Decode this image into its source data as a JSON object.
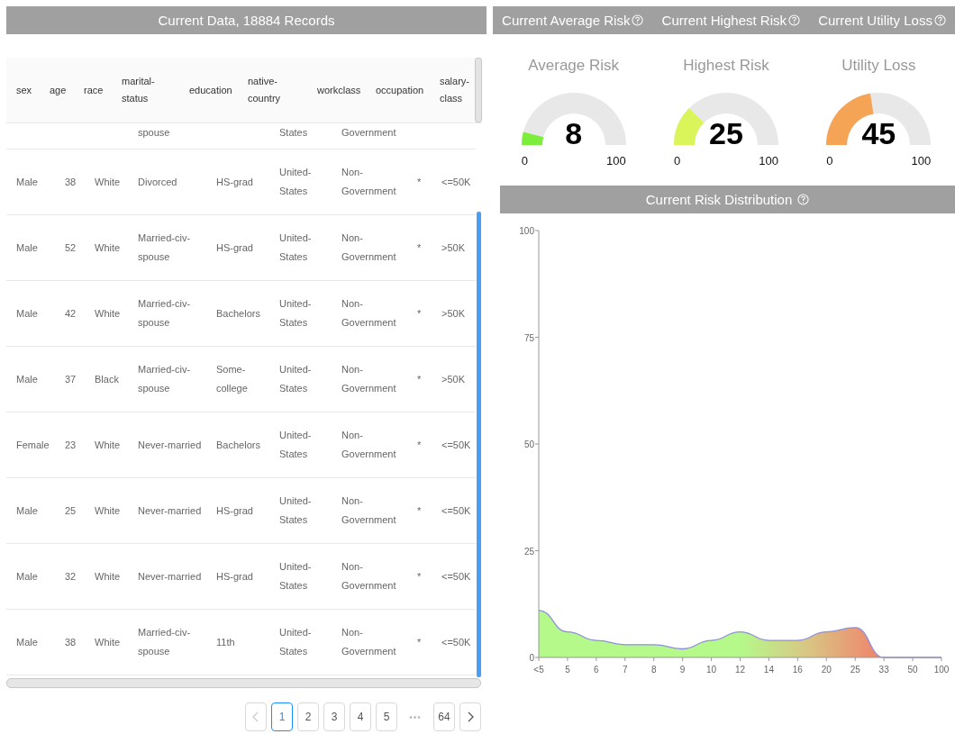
{
  "data_panel": {
    "title": "Current Data, 18884 Records",
    "columns": [
      "sex",
      "age",
      "race",
      "marital-\nstatus",
      "education",
      "native-\ncountry",
      "workclass",
      "occupation",
      "salary-\nclass"
    ],
    "partial_row": {
      "marital_status": "spouse",
      "native_country": "States",
      "workclass": "Government"
    },
    "rows": [
      [
        "Male",
        "38",
        "White",
        "Divorced",
        "HS-grad",
        "United-\nStates",
        "Non-\nGovernment",
        "*",
        "<=50K"
      ],
      [
        "Male",
        "52",
        "White",
        "Married-civ-\nspouse",
        "HS-grad",
        "United-\nStates",
        "Non-\nGovernment",
        "*",
        ">50K"
      ],
      [
        "Male",
        "42",
        "White",
        "Married-civ-\nspouse",
        "Bachelors",
        "United-\nStates",
        "Non-\nGovernment",
        "*",
        ">50K"
      ],
      [
        "Male",
        "37",
        "Black",
        "Married-civ-\nspouse",
        "Some-\ncollege",
        "United-\nStates",
        "Non-\nGovernment",
        "*",
        ">50K"
      ],
      [
        "Female",
        "23",
        "White",
        "Never-married",
        "Bachelors",
        "United-\nStates",
        "Non-\nGovernment",
        "*",
        "<=50K"
      ],
      [
        "Male",
        "25",
        "White",
        "Never-married",
        "HS-grad",
        "United-\nStates",
        "Non-\nGovernment",
        "*",
        "<=50K"
      ],
      [
        "Male",
        "32",
        "White",
        "Never-married",
        "HS-grad",
        "United-\nStates",
        "Non-\nGovernment",
        "*",
        "<=50K"
      ],
      [
        "Male",
        "38",
        "White",
        "Married-civ-\nspouse",
        "11th",
        "United-\nStates",
        "Non-\nGovernment",
        "*",
        "<=50K"
      ]
    ],
    "pagination": {
      "pages": [
        {
          "label": "1",
          "selected": true
        },
        {
          "label": "2",
          "selected": false
        },
        {
          "label": "3",
          "selected": false
        },
        {
          "label": "4",
          "selected": false
        },
        {
          "label": "5",
          "selected": false
        }
      ],
      "ellipsis": "•••",
      "last": {
        "label": "64",
        "selected": false
      }
    }
  },
  "metrics_header": [
    "Current Average Risk",
    "Current Highest Risk",
    "Current Utility Loss"
  ],
  "gauges": [
    {
      "title": "Average Risk",
      "value": "8",
      "color": "#7ded3b",
      "min": "0",
      "max": "100"
    },
    {
      "title": "Highest Risk",
      "value": "25",
      "color": "#d9f55a",
      "min": "0",
      "max": "100"
    },
    {
      "title": "Utility Loss",
      "value": "45",
      "color": "#f5a455",
      "min": "0",
      "max": "100"
    }
  ],
  "distribution": {
    "title": "Current Risk Distribution",
    "chart_data": {
      "type": "area",
      "categories": [
        "<5",
        "5",
        "6",
        "7",
        "8",
        "9",
        "10",
        "12",
        "14",
        "16",
        "20",
        "25",
        "33",
        "50",
        "100"
      ],
      "values": [
        11,
        6,
        4,
        3,
        3,
        2,
        4,
        6,
        4,
        4,
        6,
        7,
        0,
        0,
        0
      ],
      "ylim": [
        0,
        100
      ],
      "yticks": [
        0,
        25,
        50,
        75,
        100
      ]
    }
  }
}
